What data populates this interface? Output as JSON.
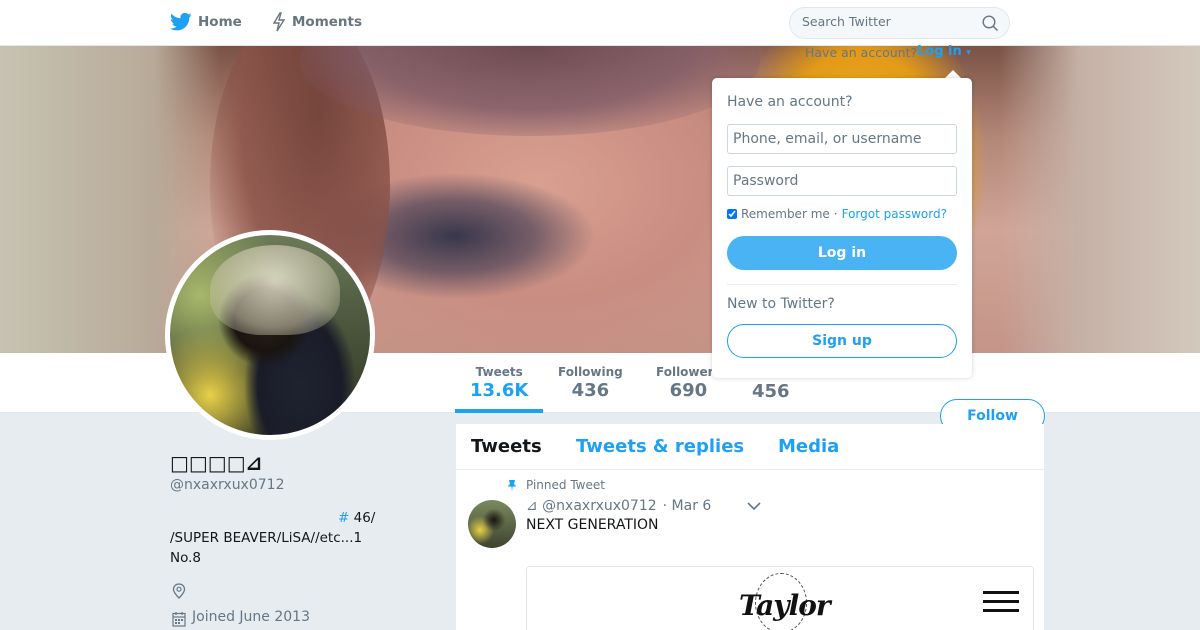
{
  "nav": {
    "home_label": "Home",
    "moments_label": "Moments",
    "search_placeholder": "Search Twitter"
  },
  "login_prompt": {
    "have_account_text": "Have an account?",
    "login_link": "Log in"
  },
  "login_dropdown": {
    "title": "Have an account?",
    "username_placeholder": "Phone, email, or username",
    "password_placeholder": "Password",
    "remember_me": "Remember me",
    "separator": "·",
    "forgot_password": "Forgot password?",
    "login_button": "Log in",
    "new_to_twitter": "New to Twitter?",
    "signup_button": "Sign up"
  },
  "profile": {
    "name": "□□□□⊿",
    "handle": "@nxaxrxux0712",
    "bio_hash": "#",
    "bio_line1": " 46/",
    "bio_line2": "/SUPER BEAVER/LiSA//etc...1",
    "bio_line3": "No.8",
    "joined": "Joined June 2013"
  },
  "stats": [
    {
      "label": "Tweets",
      "value": "13.6K"
    },
    {
      "label": "Following",
      "value": "436"
    },
    {
      "label": "Followers",
      "value": "690"
    },
    {
      "label": "",
      "value": "456"
    }
  ],
  "follow_button": "Follow",
  "timeline": {
    "tabs": [
      "Tweets",
      "Tweets & replies",
      "Media"
    ],
    "pinned_label": "Pinned Tweet",
    "tweet": {
      "author": "⊿ @nxaxrxux0712",
      "date": "· Mar 6",
      "text": "NEXT GENERATION",
      "card_logo": "Taylor"
    }
  },
  "colors": {
    "accent": "#1da1f2",
    "text_secondary": "#657786",
    "background": "#e6ecf0"
  }
}
